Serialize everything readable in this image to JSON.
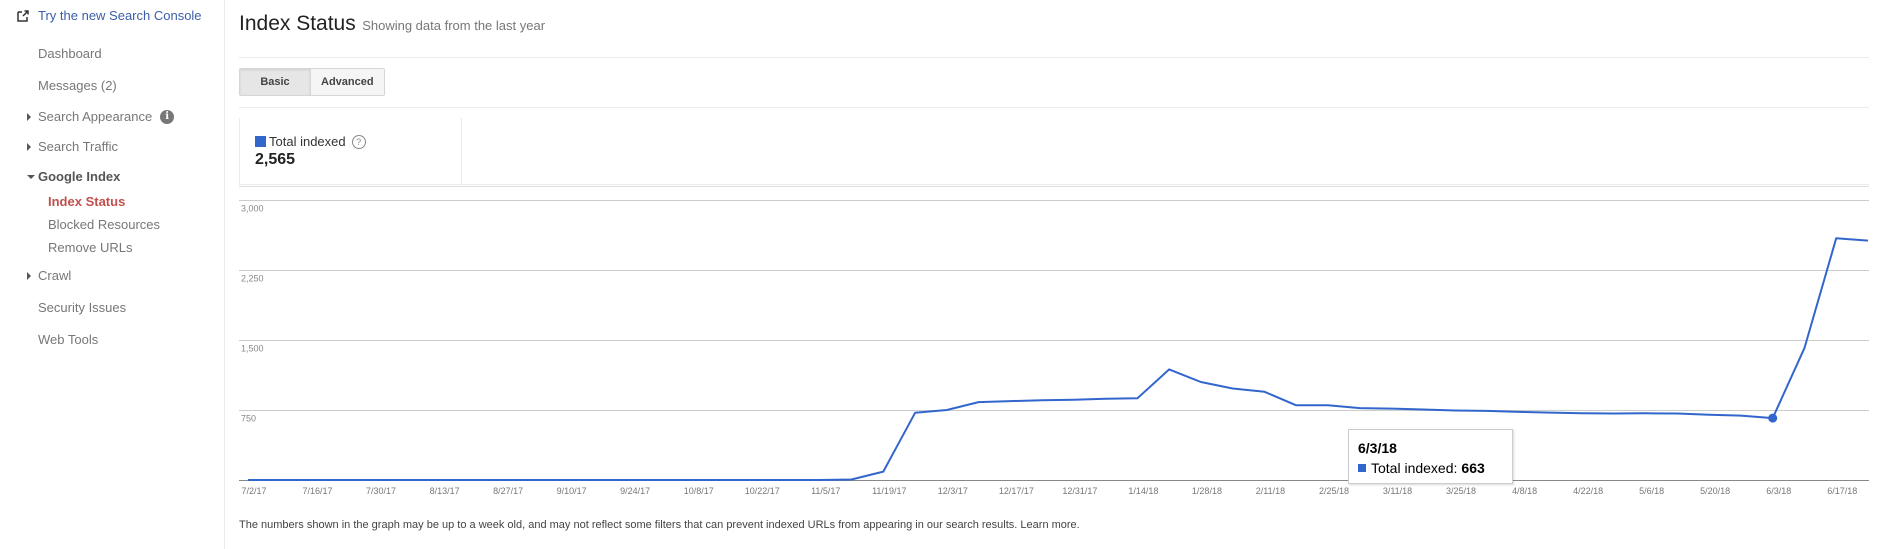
{
  "sidebar": {
    "try_new_label": "Try the new Search Console",
    "items": [
      {
        "label": "Dashboard"
      },
      {
        "label": "Messages (2)"
      },
      {
        "label": "Search Appearance"
      },
      {
        "label": "Search Traffic"
      },
      {
        "label": "Google Index"
      },
      {
        "label": "Crawl"
      },
      {
        "label": "Security Issues"
      },
      {
        "label": "Web Tools"
      }
    ],
    "google_index_children": [
      {
        "label": "Index Status",
        "active": true
      },
      {
        "label": "Blocked Resources"
      },
      {
        "label": "Remove URLs"
      }
    ],
    "info_icon_glyph": "i"
  },
  "header": {
    "title": "Index Status",
    "subtitle": "Showing data from the last year"
  },
  "tabs": {
    "basic": "Basic",
    "advanced": "Advanced",
    "selected": "Basic"
  },
  "metric": {
    "label": "Total indexed",
    "value": "2,565",
    "help_glyph": "?",
    "color": "#3366cc"
  },
  "tooltip": {
    "date": "6/3/18",
    "label": "Total indexed:",
    "value": "663"
  },
  "footnote": {
    "text": "The numbers shown in the graph may be up to a week old, and may not reflect some filters that can prevent indexed URLs from appearing in our search results.",
    "learn_more": "Learn more."
  },
  "chart_data": {
    "type": "line",
    "title": "",
    "xlabel": "",
    "ylabel": "",
    "ylim": [
      0,
      3000
    ],
    "y_ticks": [
      {
        "value": 3000,
        "label": "3,000"
      },
      {
        "value": 2250,
        "label": "2,250"
      },
      {
        "value": 1500,
        "label": "1,500"
      },
      {
        "value": 750,
        "label": "750"
      }
    ],
    "x_tick_labels": [
      "7/2/17",
      "7/16/17",
      "7/30/17",
      "8/13/17",
      "8/27/17",
      "9/10/17",
      "9/24/17",
      "10/8/17",
      "10/22/17",
      "11/5/17",
      "11/19/17",
      "12/3/17",
      "12/17/17",
      "12/31/17",
      "1/14/18",
      "1/28/18",
      "2/11/18",
      "2/25/18",
      "3/11/18",
      "3/25/18",
      "4/8/18",
      "4/22/18",
      "5/6/18",
      "5/20/18",
      "6/3/18",
      "6/17/18"
    ],
    "grid": true,
    "legend": "top-left",
    "highlight": {
      "x": "6/3/18",
      "value": 663
    },
    "color": "#3366cc",
    "series": [
      {
        "name": "Total indexed",
        "x": [
          "7/2/17",
          "7/9/17",
          "7/16/17",
          "7/23/17",
          "7/30/17",
          "8/6/17",
          "8/13/17",
          "8/20/17",
          "8/27/17",
          "9/3/17",
          "9/10/17",
          "9/17/17",
          "9/24/17",
          "10/1/17",
          "10/8/17",
          "10/15/17",
          "10/22/17",
          "10/29/17",
          "11/5/17",
          "11/12/17",
          "11/19/17",
          "11/26/17",
          "12/3/17",
          "12/10/17",
          "12/17/17",
          "12/24/17",
          "12/31/17",
          "1/7/18",
          "1/14/18",
          "1/21/18",
          "1/28/18",
          "2/4/18",
          "2/11/18",
          "2/18/18",
          "2/25/18",
          "3/4/18",
          "3/11/18",
          "3/18/18",
          "3/25/18",
          "4/1/18",
          "4/8/18",
          "4/15/18",
          "4/22/18",
          "4/29/18",
          "5/6/18",
          "5/13/18",
          "5/20/18",
          "5/27/18",
          "6/3/18",
          "6/10/18",
          "6/17/18",
          "6/24/18"
        ],
        "values": [
          0,
          0,
          0,
          0,
          0,
          0,
          0,
          0,
          0,
          0,
          0,
          0,
          0,
          0,
          0,
          0,
          0,
          0,
          0,
          5,
          90,
          720,
          750,
          835,
          845,
          855,
          860,
          870,
          875,
          1185,
          1050,
          980,
          945,
          800,
          800,
          770,
          765,
          755,
          745,
          740,
          730,
          722,
          715,
          712,
          715,
          712,
          700,
          690,
          663,
          1415,
          2590,
          2565
        ]
      }
    ]
  }
}
